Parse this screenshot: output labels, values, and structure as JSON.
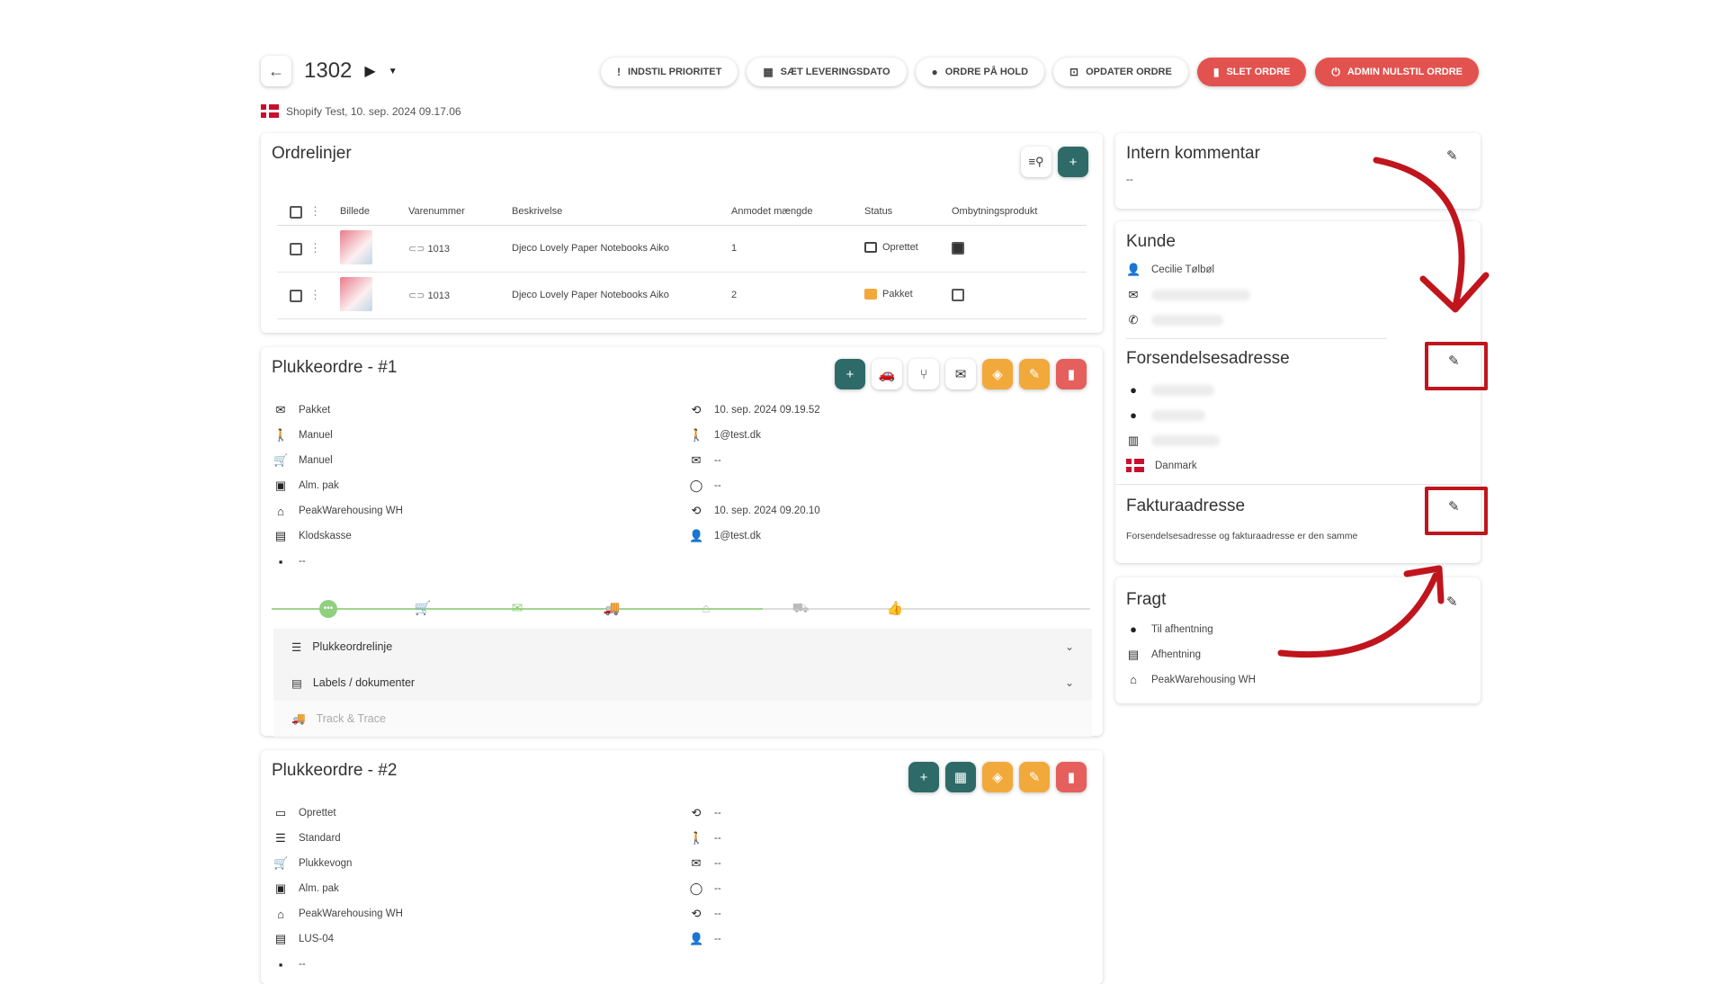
{
  "header": {
    "order_number": "1302",
    "subtitle": "Shopify Test, 10. sep. 2024 09.17.06",
    "actions": [
      {
        "label": "Indstil prioritet",
        "icon": "!",
        "style": "plain"
      },
      {
        "label": "Sæt leveringsdato",
        "icon": "▦",
        "style": "plain"
      },
      {
        "label": "Ordre på hold",
        "icon": "●",
        "style": "plain"
      },
      {
        "label": "Opdater ordre",
        "icon": "⊡",
        "style": "plain"
      },
      {
        "label": "Slet ordre",
        "icon": "🗑",
        "style": "red"
      },
      {
        "label": "Admin nulstil ordre",
        "icon": "⏻",
        "style": "red"
      }
    ]
  },
  "orderlines": {
    "title": "Ordrelinjer",
    "columns": [
      "Billede",
      "Varenummer",
      "Beskrivelse",
      "Anmodet mængde",
      "Status",
      "Ombytningsprodukt"
    ],
    "rows": [
      {
        "sku": "1013",
        "description": "Djeco Lovely Paper Notebooks Aiko",
        "qty": "1",
        "status": "Oprettet",
        "exchange": true
      },
      {
        "sku": "1013",
        "description": "Djeco Lovely Paper Notebooks Aiko",
        "qty": "2",
        "status": "Pakket",
        "exchange": false
      }
    ]
  },
  "pick1": {
    "title": "Plukkeordre - #1",
    "left": [
      {
        "icon": "✉",
        "text": "Pakket"
      },
      {
        "icon": "🚶",
        "text": "Manuel"
      },
      {
        "icon": "🛒",
        "text": "Manuel"
      },
      {
        "icon": "▣",
        "text": "Alm. pak"
      },
      {
        "icon": "⌂",
        "text": "PeakWarehousing WH"
      },
      {
        "icon": "▤",
        "text": "Klodskasse"
      },
      {
        "icon": "▪",
        "text": "--"
      }
    ],
    "right": [
      {
        "icon": "⟲",
        "text": "10. sep. 2024 09.19.52"
      },
      {
        "icon": "🚶",
        "text": "1@test.dk"
      },
      {
        "icon": "✉",
        "text": "--"
      },
      {
        "icon": "◯",
        "text": "--"
      },
      {
        "icon": "⟲",
        "text": "10. sep. 2024 09.20.10"
      },
      {
        "icon": "👤",
        "text": "1@test.dk"
      }
    ],
    "timeline_progress": 0.6,
    "sections": [
      "Plukkeordrelinje",
      "Labels / dokumenter",
      "Track & Trace"
    ]
  },
  "pick2": {
    "title": "Plukkeordre - #2",
    "left": [
      {
        "icon": "▭",
        "text": "Oprettet"
      },
      {
        "icon": "☰",
        "text": "Standard"
      },
      {
        "icon": "🛒",
        "text": "Plukkevogn"
      },
      {
        "icon": "▣",
        "text": "Alm. pak"
      },
      {
        "icon": "⌂",
        "text": "PeakWarehousing WH"
      },
      {
        "icon": "▤",
        "text": "LUS-04"
      },
      {
        "icon": "▪",
        "text": "--"
      }
    ],
    "right": [
      {
        "icon": "⟲",
        "text": "--"
      },
      {
        "icon": "🚶",
        "text": "--"
      },
      {
        "icon": "✉",
        "text": "--"
      },
      {
        "icon": "◯",
        "text": "--"
      },
      {
        "icon": "⟲",
        "text": "--"
      },
      {
        "icon": "👤",
        "text": "--"
      }
    ]
  },
  "comment": {
    "title": "Intern kommentar",
    "value": "--"
  },
  "customer": {
    "title": "Kunde",
    "name": "Cecilie Tølbøl"
  },
  "shipping": {
    "title": "Forsendelsesadresse",
    "country": "Danmark"
  },
  "billing": {
    "title": "Fakturaadresse",
    "note": "Forsendelsesadresse og fakturaadresse er den samme"
  },
  "freight": {
    "title": "Fragt",
    "rows": [
      {
        "icon": "📍",
        "text": "Til afhentning"
      },
      {
        "icon": "▤",
        "text": "Afhentning"
      },
      {
        "icon": "⌂",
        "text": "PeakWarehousing WH"
      }
    ]
  },
  "colors": {
    "accent_teal": "#2e6b68",
    "danger": "#e2524f",
    "warning": "#f2a93b",
    "highlight": "#c0151d",
    "progress": "#8fcf7e"
  }
}
